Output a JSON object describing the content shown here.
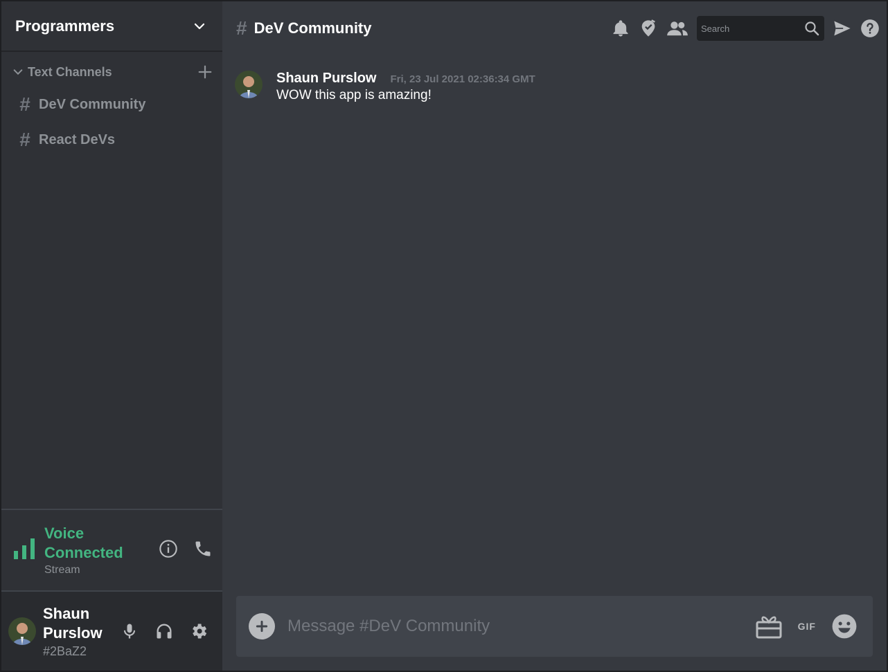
{
  "server": {
    "name": "Programmers"
  },
  "channels": {
    "category": "Text Channels",
    "items": [
      {
        "hash": "#",
        "label": "DeV Community"
      },
      {
        "hash": "#",
        "label": "React DeVs"
      }
    ]
  },
  "voice": {
    "status": "Voice Connected",
    "sub": "Stream"
  },
  "user": {
    "name": "Shaun Purslow",
    "tag": "#2BaZ2"
  },
  "topbar": {
    "hash": "#",
    "channel": "DeV Community",
    "search_placeholder": "Search"
  },
  "messages": [
    {
      "author": "Shaun Purslow",
      "time": "Fri, 23 Jul 2021 02:36:34 GMT",
      "text": "WOW this app is amazing!"
    }
  ],
  "composer": {
    "placeholder": "Message #DeV Community",
    "gif_label": "GIF"
  },
  "colors": {
    "accent_green": "#43b581",
    "bg_main": "#36393f",
    "bg_sidebar": "#2f3136",
    "icon_gray": "#b9bbbe"
  }
}
